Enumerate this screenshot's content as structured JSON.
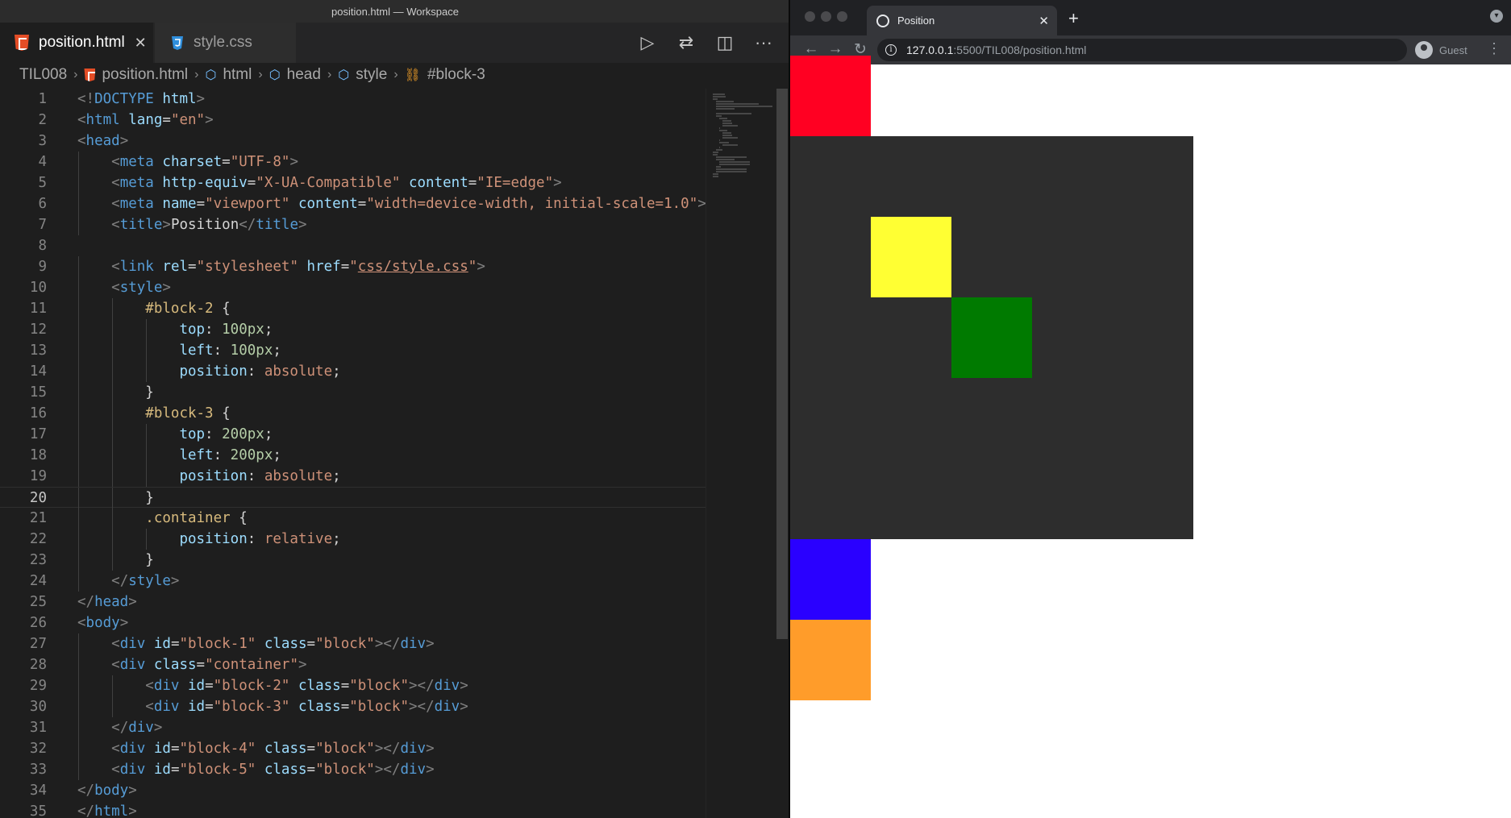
{
  "editor": {
    "window_title": "position.html — Workspace",
    "tabs": [
      {
        "label": "position.html",
        "icon": "html5-icon",
        "active": true
      },
      {
        "label": "style.css",
        "icon": "css3-icon",
        "active": false
      }
    ],
    "actions": {
      "run": "▷",
      "compare": "⇄",
      "split": "◫",
      "more": "···"
    },
    "breadcrumb": [
      "TIL008",
      "position.html",
      "html",
      "head",
      "style",
      "#block-3"
    ],
    "active_line": 20,
    "code_lines": [
      [
        [
          "b",
          "<!"
        ],
        [
          "g",
          "DOCTYPE"
        ],
        [
          "x",
          " "
        ],
        [
          "a",
          "html"
        ],
        [
          "b",
          ">"
        ]
      ],
      [
        [
          "b",
          "<"
        ],
        [
          "g",
          "html"
        ],
        [
          "x",
          " "
        ],
        [
          "a",
          "lang"
        ],
        [
          "x",
          "="
        ],
        [
          "s",
          "\"en\""
        ],
        [
          "b",
          ">"
        ]
      ],
      [
        [
          "b",
          "<"
        ],
        [
          "g",
          "head"
        ],
        [
          "b",
          ">"
        ]
      ],
      [
        [
          "x",
          "    "
        ],
        [
          "b",
          "<"
        ],
        [
          "g",
          "meta"
        ],
        [
          "x",
          " "
        ],
        [
          "a",
          "charset"
        ],
        [
          "x",
          "="
        ],
        [
          "s",
          "\"UTF-8\""
        ],
        [
          "b",
          ">"
        ]
      ],
      [
        [
          "x",
          "    "
        ],
        [
          "b",
          "<"
        ],
        [
          "g",
          "meta"
        ],
        [
          "x",
          " "
        ],
        [
          "a",
          "http-equiv"
        ],
        [
          "x",
          "="
        ],
        [
          "s",
          "\"X-UA-Compatible\""
        ],
        [
          "x",
          " "
        ],
        [
          "a",
          "content"
        ],
        [
          "x",
          "="
        ],
        [
          "s",
          "\"IE=edge\""
        ],
        [
          "b",
          ">"
        ]
      ],
      [
        [
          "x",
          "    "
        ],
        [
          "b",
          "<"
        ],
        [
          "g",
          "meta"
        ],
        [
          "x",
          " "
        ],
        [
          "a",
          "name"
        ],
        [
          "x",
          "="
        ],
        [
          "s",
          "\"viewport\""
        ],
        [
          "x",
          " "
        ],
        [
          "a",
          "content"
        ],
        [
          "x",
          "="
        ],
        [
          "s",
          "\"width=device-width, initial-scale=1.0\""
        ],
        [
          "b",
          ">"
        ]
      ],
      [
        [
          "x",
          "    "
        ],
        [
          "b",
          "<"
        ],
        [
          "g",
          "title"
        ],
        [
          "b",
          ">"
        ],
        [
          "x",
          "Position"
        ],
        [
          "b",
          "</"
        ],
        [
          "g",
          "title"
        ],
        [
          "b",
          ">"
        ]
      ],
      [],
      [
        [
          "x",
          "    "
        ],
        [
          "b",
          "<"
        ],
        [
          "g",
          "link"
        ],
        [
          "x",
          " "
        ],
        [
          "a",
          "rel"
        ],
        [
          "x",
          "="
        ],
        [
          "s",
          "\"stylesheet\""
        ],
        [
          "x",
          " "
        ],
        [
          "a",
          "href"
        ],
        [
          "x",
          "="
        ],
        [
          "s",
          "\""
        ],
        [
          "u",
          "css/style.css"
        ],
        [
          "s",
          "\""
        ],
        [
          "b",
          ">"
        ]
      ],
      [
        [
          "x",
          "    "
        ],
        [
          "b",
          "<"
        ],
        [
          "g",
          "style"
        ],
        [
          "b",
          ">"
        ]
      ],
      [
        [
          "x",
          "        "
        ],
        [
          "c",
          "#block-2"
        ],
        [
          "x",
          " {"
        ]
      ],
      [
        [
          "x",
          "            "
        ],
        [
          "p",
          "top"
        ],
        [
          "x",
          ": "
        ],
        [
          "n",
          "100px"
        ],
        [
          "x",
          ";"
        ]
      ],
      [
        [
          "x",
          "            "
        ],
        [
          "p",
          "left"
        ],
        [
          "x",
          ": "
        ],
        [
          "n",
          "100px"
        ],
        [
          "x",
          ";"
        ]
      ],
      [
        [
          "x",
          "            "
        ],
        [
          "p",
          "position"
        ],
        [
          "x",
          ": "
        ],
        [
          "v",
          "absolute"
        ],
        [
          "x",
          ";"
        ]
      ],
      [
        [
          "x",
          "        }"
        ]
      ],
      [
        [
          "x",
          "        "
        ],
        [
          "c",
          "#block-3"
        ],
        [
          "x",
          " {"
        ]
      ],
      [
        [
          "x",
          "            "
        ],
        [
          "p",
          "top"
        ],
        [
          "x",
          ": "
        ],
        [
          "n",
          "200px"
        ],
        [
          "x",
          ";"
        ]
      ],
      [
        [
          "x",
          "            "
        ],
        [
          "p",
          "left"
        ],
        [
          "x",
          ": "
        ],
        [
          "n",
          "200px"
        ],
        [
          "x",
          ";"
        ]
      ],
      [
        [
          "x",
          "            "
        ],
        [
          "p",
          "position"
        ],
        [
          "x",
          ": "
        ],
        [
          "v",
          "absolute"
        ],
        [
          "x",
          ";"
        ]
      ],
      [
        [
          "x",
          "        }"
        ]
      ],
      [
        [
          "x",
          "        "
        ],
        [
          "c",
          ".container"
        ],
        [
          "x",
          " {"
        ]
      ],
      [
        [
          "x",
          "            "
        ],
        [
          "p",
          "position"
        ],
        [
          "x",
          ": "
        ],
        [
          "v",
          "relative"
        ],
        [
          "x",
          ";"
        ]
      ],
      [
        [
          "x",
          "        }"
        ]
      ],
      [
        [
          "x",
          "    "
        ],
        [
          "b",
          "</"
        ],
        [
          "g",
          "style"
        ],
        [
          "b",
          ">"
        ]
      ],
      [
        [
          "b",
          "</"
        ],
        [
          "g",
          "head"
        ],
        [
          "b",
          ">"
        ]
      ],
      [
        [
          "b",
          "<"
        ],
        [
          "g",
          "body"
        ],
        [
          "b",
          ">"
        ]
      ],
      [
        [
          "x",
          "    "
        ],
        [
          "b",
          "<"
        ],
        [
          "g",
          "div"
        ],
        [
          "x",
          " "
        ],
        [
          "a",
          "id"
        ],
        [
          "x",
          "="
        ],
        [
          "s",
          "\"block-1\""
        ],
        [
          "x",
          " "
        ],
        [
          "a",
          "class"
        ],
        [
          "x",
          "="
        ],
        [
          "s",
          "\"block\""
        ],
        [
          "b",
          "></"
        ],
        [
          "g",
          "div"
        ],
        [
          "b",
          ">"
        ]
      ],
      [
        [
          "x",
          "    "
        ],
        [
          "b",
          "<"
        ],
        [
          "g",
          "div"
        ],
        [
          "x",
          " "
        ],
        [
          "a",
          "class"
        ],
        [
          "x",
          "="
        ],
        [
          "s",
          "\"container\""
        ],
        [
          "b",
          ">"
        ]
      ],
      [
        [
          "x",
          "        "
        ],
        [
          "b",
          "<"
        ],
        [
          "g",
          "div"
        ],
        [
          "x",
          " "
        ],
        [
          "a",
          "id"
        ],
        [
          "x",
          "="
        ],
        [
          "s",
          "\"block-2\""
        ],
        [
          "x",
          " "
        ],
        [
          "a",
          "class"
        ],
        [
          "x",
          "="
        ],
        [
          "s",
          "\"block\""
        ],
        [
          "b",
          "></"
        ],
        [
          "g",
          "div"
        ],
        [
          "b",
          ">"
        ]
      ],
      [
        [
          "x",
          "        "
        ],
        [
          "b",
          "<"
        ],
        [
          "g",
          "div"
        ],
        [
          "x",
          " "
        ],
        [
          "a",
          "id"
        ],
        [
          "x",
          "="
        ],
        [
          "s",
          "\"block-3\""
        ],
        [
          "x",
          " "
        ],
        [
          "a",
          "class"
        ],
        [
          "x",
          "="
        ],
        [
          "s",
          "\"block\""
        ],
        [
          "b",
          "></"
        ],
        [
          "g",
          "div"
        ],
        [
          "b",
          ">"
        ]
      ],
      [
        [
          "x",
          "    "
        ],
        [
          "b",
          "</"
        ],
        [
          "g",
          "div"
        ],
        [
          "b",
          ">"
        ]
      ],
      [
        [
          "x",
          "    "
        ],
        [
          "b",
          "<"
        ],
        [
          "g",
          "div"
        ],
        [
          "x",
          " "
        ],
        [
          "a",
          "id"
        ],
        [
          "x",
          "="
        ],
        [
          "s",
          "\"block-4\""
        ],
        [
          "x",
          " "
        ],
        [
          "a",
          "class"
        ],
        [
          "x",
          "="
        ],
        [
          "s",
          "\"block\""
        ],
        [
          "b",
          "></"
        ],
        [
          "g",
          "div"
        ],
        [
          "b",
          ">"
        ]
      ],
      [
        [
          "x",
          "    "
        ],
        [
          "b",
          "<"
        ],
        [
          "g",
          "div"
        ],
        [
          "x",
          " "
        ],
        [
          "a",
          "id"
        ],
        [
          "x",
          "="
        ],
        [
          "s",
          "\"block-5\""
        ],
        [
          "x",
          " "
        ],
        [
          "a",
          "class"
        ],
        [
          "x",
          "="
        ],
        [
          "s",
          "\"block\""
        ],
        [
          "b",
          "></"
        ],
        [
          "g",
          "div"
        ],
        [
          "b",
          ">"
        ]
      ],
      [
        [
          "b",
          "</"
        ],
        [
          "g",
          "body"
        ],
        [
          "b",
          ">"
        ]
      ],
      [
        [
          "b",
          "</"
        ],
        [
          "g",
          "html"
        ],
        [
          "b",
          ">"
        ]
      ]
    ]
  },
  "browser": {
    "tab_title": "Position",
    "url_host": "127.0.0.1",
    "url_path": ":5500/TIL008/position.html",
    "profile_label": "Guest",
    "page": {
      "block_colors": {
        "block-1": "#ff0022",
        "container": "#2d2d2d",
        "block-2": "#ffff33",
        "block-3": "#007a00",
        "block-4": "#2a00ff",
        "block-5": "#ff9c2a"
      }
    }
  }
}
